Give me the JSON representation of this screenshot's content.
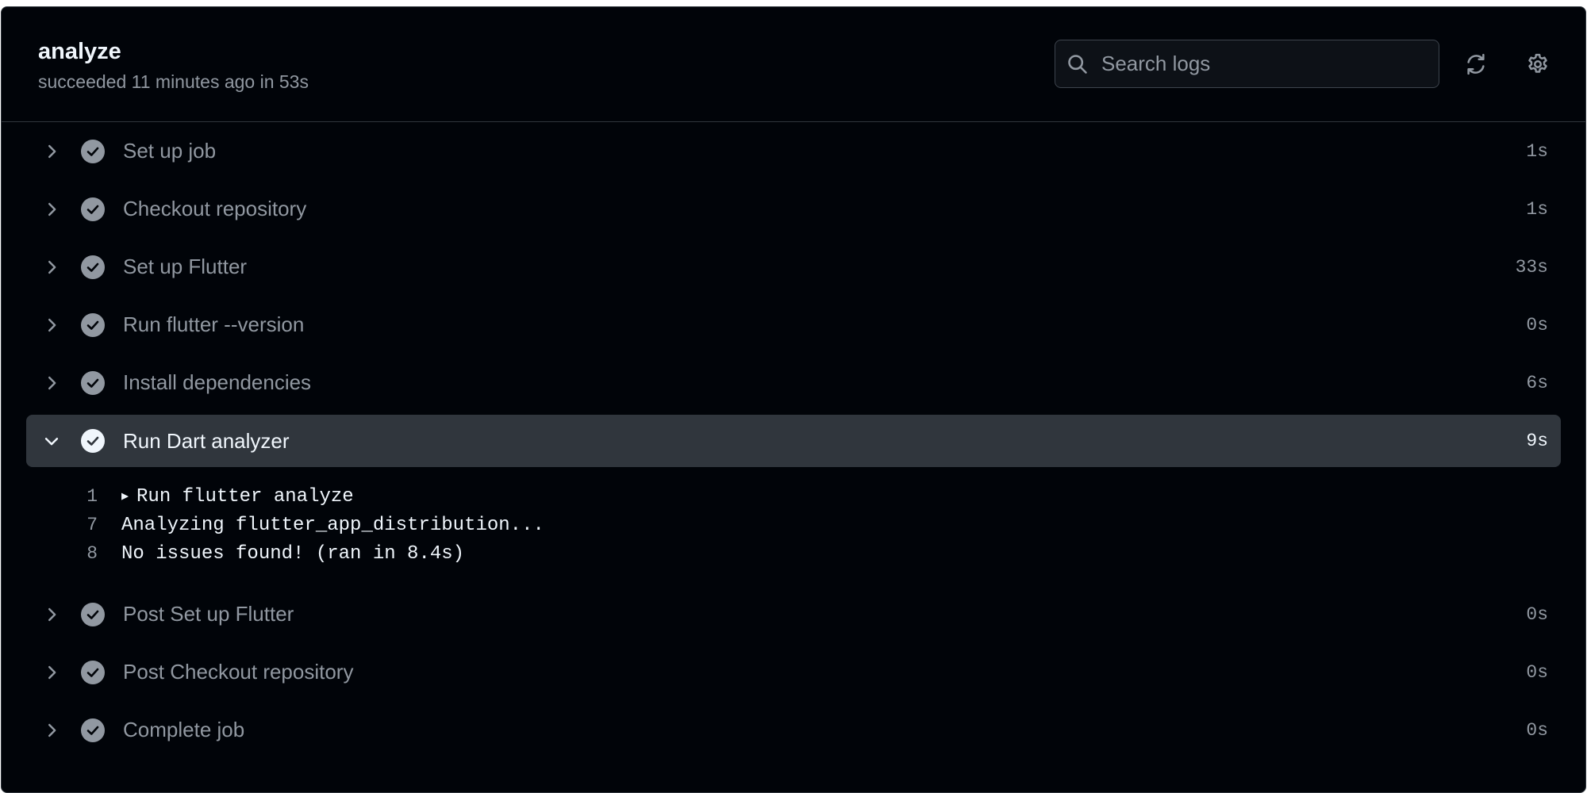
{
  "job": {
    "title": "analyze",
    "subtitle": "succeeded 11 minutes ago in 53s"
  },
  "search": {
    "placeholder": "Search logs"
  },
  "toolbar": {
    "refresh_icon": "sync-icon",
    "settings_icon": "gear-icon"
  },
  "steps_before": [
    {
      "label": "Set up job",
      "duration": "1s"
    },
    {
      "label": "Checkout repository",
      "duration": "1s"
    },
    {
      "label": "Set up Flutter",
      "duration": "33s"
    },
    {
      "label": "Run flutter --version",
      "duration": "0s"
    },
    {
      "label": "Install dependencies",
      "duration": "6s"
    }
  ],
  "expanded_step": {
    "label": "Run Dart analyzer",
    "duration": "9s",
    "log": [
      {
        "num": "1",
        "caret": "▶",
        "text": "Run flutter analyze"
      },
      {
        "num": "7",
        "caret": "",
        "text": "Analyzing flutter_app_distribution..."
      },
      {
        "num": "8",
        "caret": "",
        "text": "No issues found! (ran in 8.4s)"
      }
    ]
  },
  "steps_after": [
    {
      "label": "Post Set up Flutter",
      "duration": "0s"
    },
    {
      "label": "Post Checkout repository",
      "duration": "0s"
    },
    {
      "label": "Complete job",
      "duration": "0s"
    }
  ],
  "colors": {
    "background": "#010409",
    "border": "#30363d",
    "muted_text": "#9198a1",
    "bright_text": "#f0f6fc",
    "check_done": "#9198a1",
    "check_expanded": "#f0f6fc"
  }
}
